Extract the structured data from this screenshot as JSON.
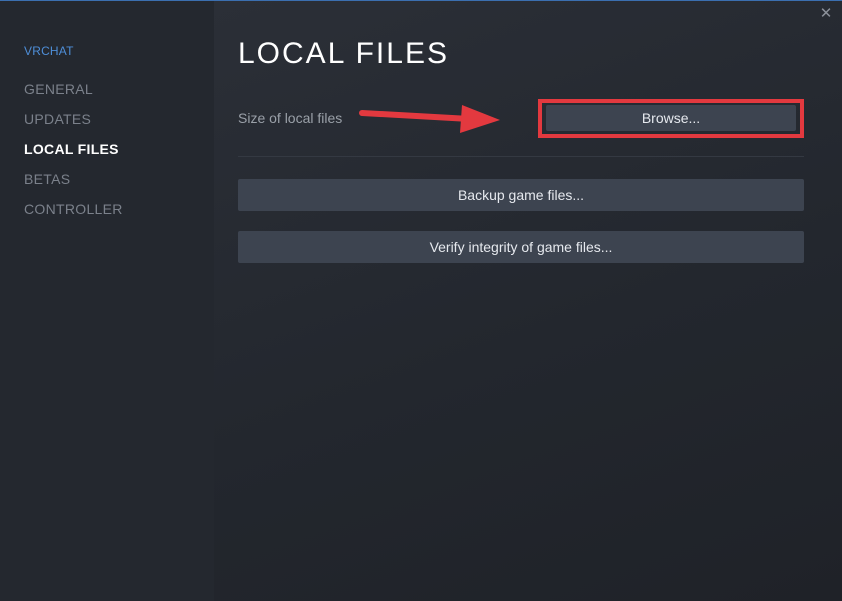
{
  "game": {
    "title": "VRCHAT"
  },
  "sidebar": {
    "items": [
      {
        "label": "GENERAL",
        "active": false
      },
      {
        "label": "UPDATES",
        "active": false
      },
      {
        "label": "LOCAL FILES",
        "active": true
      },
      {
        "label": "BETAS",
        "active": false
      },
      {
        "label": "CONTROLLER",
        "active": false
      }
    ]
  },
  "window": {
    "close_icon": "close-icon"
  },
  "main": {
    "title": "LOCAL FILES",
    "size_label": "Size of local files",
    "browse_label": "Browse...",
    "backup_label": "Backup game files...",
    "verify_label": "Verify integrity of game files..."
  },
  "colors": {
    "accent": "#4e8ed8",
    "annotation": "#e3393f",
    "button": "#3d4450"
  }
}
